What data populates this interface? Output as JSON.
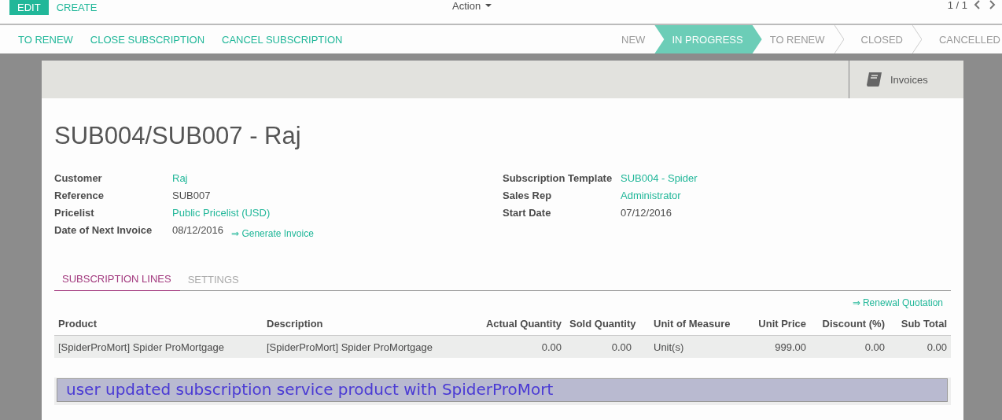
{
  "control_panel": {
    "buttons": [
      {
        "label": "EDIT",
        "kind": "primary"
      },
      {
        "label": "CREATE",
        "kind": "link"
      }
    ],
    "action_menu": "Action",
    "pager": "1 / 1"
  },
  "statusbar": {
    "buttons": [
      "TO RENEW",
      "CLOSE SUBSCRIPTION",
      "CANCEL SUBSCRIPTION"
    ],
    "stages": [
      {
        "label": "NEW",
        "selected": false
      },
      {
        "label": "IN PROGRESS",
        "selected": true
      },
      {
        "label": "TO RENEW",
        "selected": false
      },
      {
        "label": "CLOSED",
        "selected": false
      },
      {
        "label": "CANCELLED",
        "selected": false
      }
    ]
  },
  "smart_button": {
    "label": "Invoices"
  },
  "title": "SUB004/SUB007 - Raj",
  "fields_left": [
    {
      "label": "Customer",
      "value": "Raj",
      "kind": "link"
    },
    {
      "label": "Reference",
      "value": "SUB007",
      "kind": "text"
    },
    {
      "label": "Pricelist",
      "value": "Public Pricelist (USD)",
      "kind": "link"
    },
    {
      "label": "Date of Next Invoice",
      "value": "08/12/2016",
      "kind": "text",
      "action": "⇒ Generate Invoice"
    }
  ],
  "fields_right": [
    {
      "label": "Subscription Template",
      "value": "SUB004 - Spider",
      "kind": "link"
    },
    {
      "label": "Sales Rep",
      "value": "Administrator",
      "kind": "link"
    },
    {
      "label": "Start Date",
      "value": "07/12/2016",
      "kind": "text"
    }
  ],
  "tabs": [
    {
      "label": "SUBSCRIPTION LINES",
      "selected": true
    },
    {
      "label": "SETTINGS",
      "selected": false
    }
  ],
  "table_action": "⇒ Renewal Quotation",
  "table": {
    "columns": [
      {
        "label": "Product",
        "kind": "text"
      },
      {
        "label": "Description",
        "kind": "text"
      },
      {
        "label": "Actual Quantity",
        "kind": "number"
      },
      {
        "label": "Sold Quantity",
        "kind": "number"
      },
      {
        "label": "Unit of Measure",
        "kind": "text"
      },
      {
        "label": "Unit Price",
        "kind": "number"
      },
      {
        "label": "Discount (%)",
        "kind": "number"
      },
      {
        "label": "Sub Total",
        "kind": "number"
      }
    ],
    "rows": [
      [
        "[SpiderProMort] Spider ProMortgage",
        "[SpiderProMort] Spider ProMortgage",
        "0.00",
        "0.00",
        "Unit(s)",
        "999.00",
        "0.00",
        "0.00"
      ]
    ]
  },
  "annotation": "user updated subscription service product with SpiderProMort"
}
